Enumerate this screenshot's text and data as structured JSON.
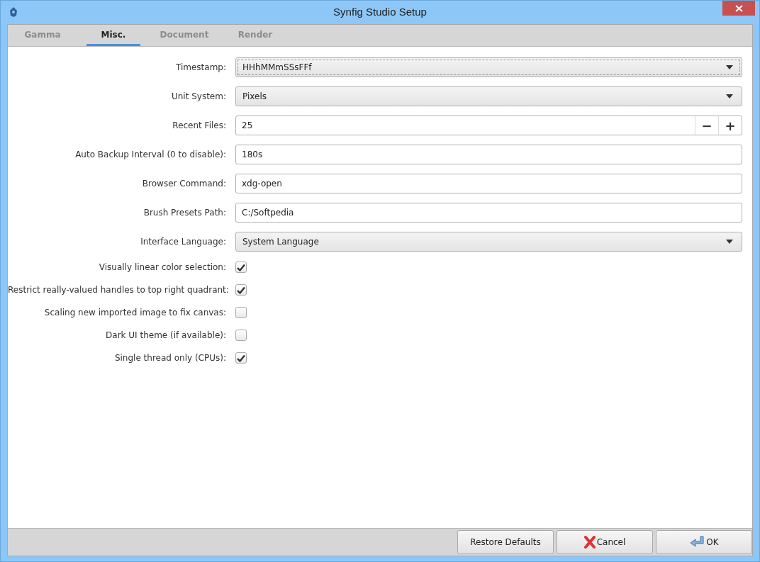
{
  "window": {
    "title": "Synfig Studio Setup"
  },
  "tabs": [
    {
      "label": "Gamma",
      "selected": false
    },
    {
      "label": "Misc.",
      "selected": true
    },
    {
      "label": "Document",
      "selected": false
    },
    {
      "label": "Render",
      "selected": false
    }
  ],
  "fields": [
    {
      "label": "Timestamp:",
      "kind": "dropdown",
      "value": "HHhMMmSSsFFf",
      "focused": true
    },
    {
      "label": "Unit System:",
      "kind": "dropdown",
      "value": "Pixels",
      "focused": false
    },
    {
      "label": "Recent Files:",
      "kind": "spin",
      "value": "25",
      "decrement": "−",
      "increment": "+"
    },
    {
      "label": "Auto Backup Interval (0 to disable):",
      "kind": "text",
      "value": "180s"
    },
    {
      "label": "Browser Command:",
      "kind": "text",
      "value": "xdg-open"
    },
    {
      "label": "Brush Presets Path:",
      "kind": "text",
      "value": "C:/Softpedia"
    },
    {
      "label": "Interface Language:",
      "kind": "dropdown",
      "value": "System Language",
      "focused": false
    }
  ],
  "checkboxes": [
    {
      "label": "Visually linear color selection:",
      "checked": true
    },
    {
      "label": "Restrict really-valued handles to top right quadrant:",
      "checked": true
    },
    {
      "label": "Scaling new imported image to fix canvas:",
      "checked": false
    },
    {
      "label": "Dark UI theme (if available):",
      "checked": false
    },
    {
      "label": "Single thread only (CPUs):",
      "checked": true
    }
  ],
  "buttons": [
    {
      "label": "Restore Defaults",
      "kind": "plain"
    },
    {
      "label": "Cancel",
      "kind": "cancel"
    },
    {
      "label": "OK",
      "kind": "ok"
    }
  ]
}
